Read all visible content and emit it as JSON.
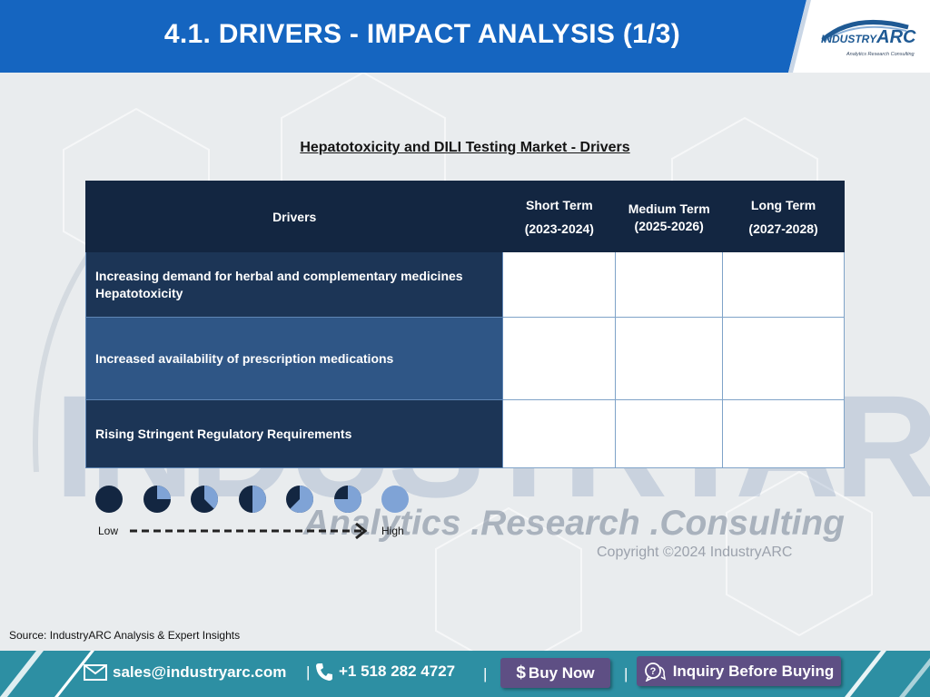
{
  "header": {
    "title": "4.1. DRIVERS - IMPACT ANALYSIS (1/3)"
  },
  "logo": {
    "word_prefix": "INDUSTRY",
    "word_suffix": "ARC",
    "tagline": "Analytics Research Consulting"
  },
  "subtitle": "Hepatotoxicity and DILI Testing Market - Drivers",
  "table": {
    "headers": [
      {
        "line1": "Drivers",
        "line2": ""
      },
      {
        "line1": "Short Term",
        "line2": "(2023-2024)"
      },
      {
        "line1": "Medium Term",
        "line2": "(2025-2026)"
      },
      {
        "line1": "Long Term",
        "line2": "(2027-2028)"
      }
    ],
    "rows": [
      {
        "driver_line1": "Increasing demand for herbal and complementary medicines",
        "driver_line2": "Hepatotoxicity"
      },
      {
        "driver_line1": "Increased availability of prescription medications",
        "driver_line2": ""
      },
      {
        "driver_line1": "Rising Stringent Regulatory Requirements",
        "driver_line2": ""
      }
    ]
  },
  "legend": {
    "low_label": "Low",
    "high_label": "High",
    "pie_light_fractions": [
      0,
      0.25,
      0.375,
      0.5,
      0.625,
      0.75,
      1
    ]
  },
  "watermark": {
    "word": "INDUSTRYARC",
    "tagline": "Analytics .Research .Consulting",
    "copyright": "Copyright ©2024 IndustryARC"
  },
  "source": "Source: IndustryARC Analysis & Expert Insights",
  "footer": {
    "email": "sales@industryarc.com",
    "phone": "+1 518 282 4727",
    "buy_label": "Buy Now",
    "inquiry_label": "Inquiry Before Buying",
    "separator": "|"
  },
  "colors": {
    "header_blue": "#1565c0",
    "table_header": "#132641",
    "row_dark": "#1c3556",
    "row_mid": "#2f5686",
    "pie_dark": "#132641",
    "pie_light": "#7fa3d6",
    "footer_teal": "#2d8fa3",
    "button_purple": "#5e4f84"
  }
}
